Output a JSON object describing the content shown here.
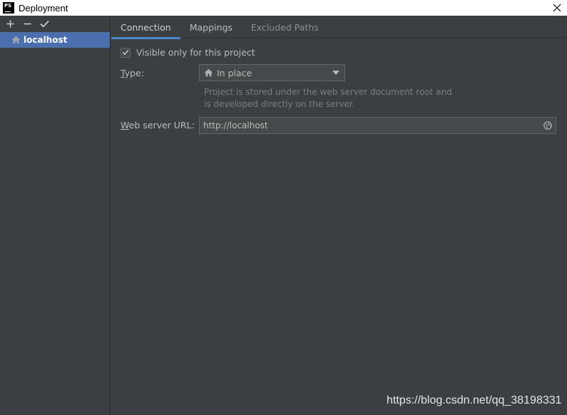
{
  "window": {
    "app_icon_label": "PS",
    "title": "Deployment",
    "close_icon": "close-icon"
  },
  "left_toolbar": {
    "add": "+",
    "remove": "−",
    "default": "✔"
  },
  "servers": [
    {
      "label": "localhost",
      "icon": "home-icon",
      "selected": true
    }
  ],
  "tabs": [
    {
      "label": "Connection",
      "active": true
    },
    {
      "label": "Mappings",
      "active": false
    },
    {
      "label": "Excluded Paths",
      "active": false
    }
  ],
  "connection": {
    "visible_only": {
      "label": "Visible only for this project",
      "checked": true
    },
    "type": {
      "label_mnemonic": "T",
      "label_rest": "ype:",
      "value": "In place",
      "icon": "home-icon"
    },
    "hint_line1": "Project is stored under the web server document root and",
    "hint_line2": "is developed directly on the server.",
    "web_server_url": {
      "label_mnemonic": "W",
      "label_rest": "eb server URL:",
      "value": "http://localhost",
      "icon": "globe-icon"
    }
  },
  "watermark": "https://blog.csdn.net/qq_38198331",
  "colors": {
    "background": "#3c3f41",
    "selection": "#4b6eaf",
    "tab_underline": "#4a88c7",
    "text": "#bbbbbb"
  }
}
